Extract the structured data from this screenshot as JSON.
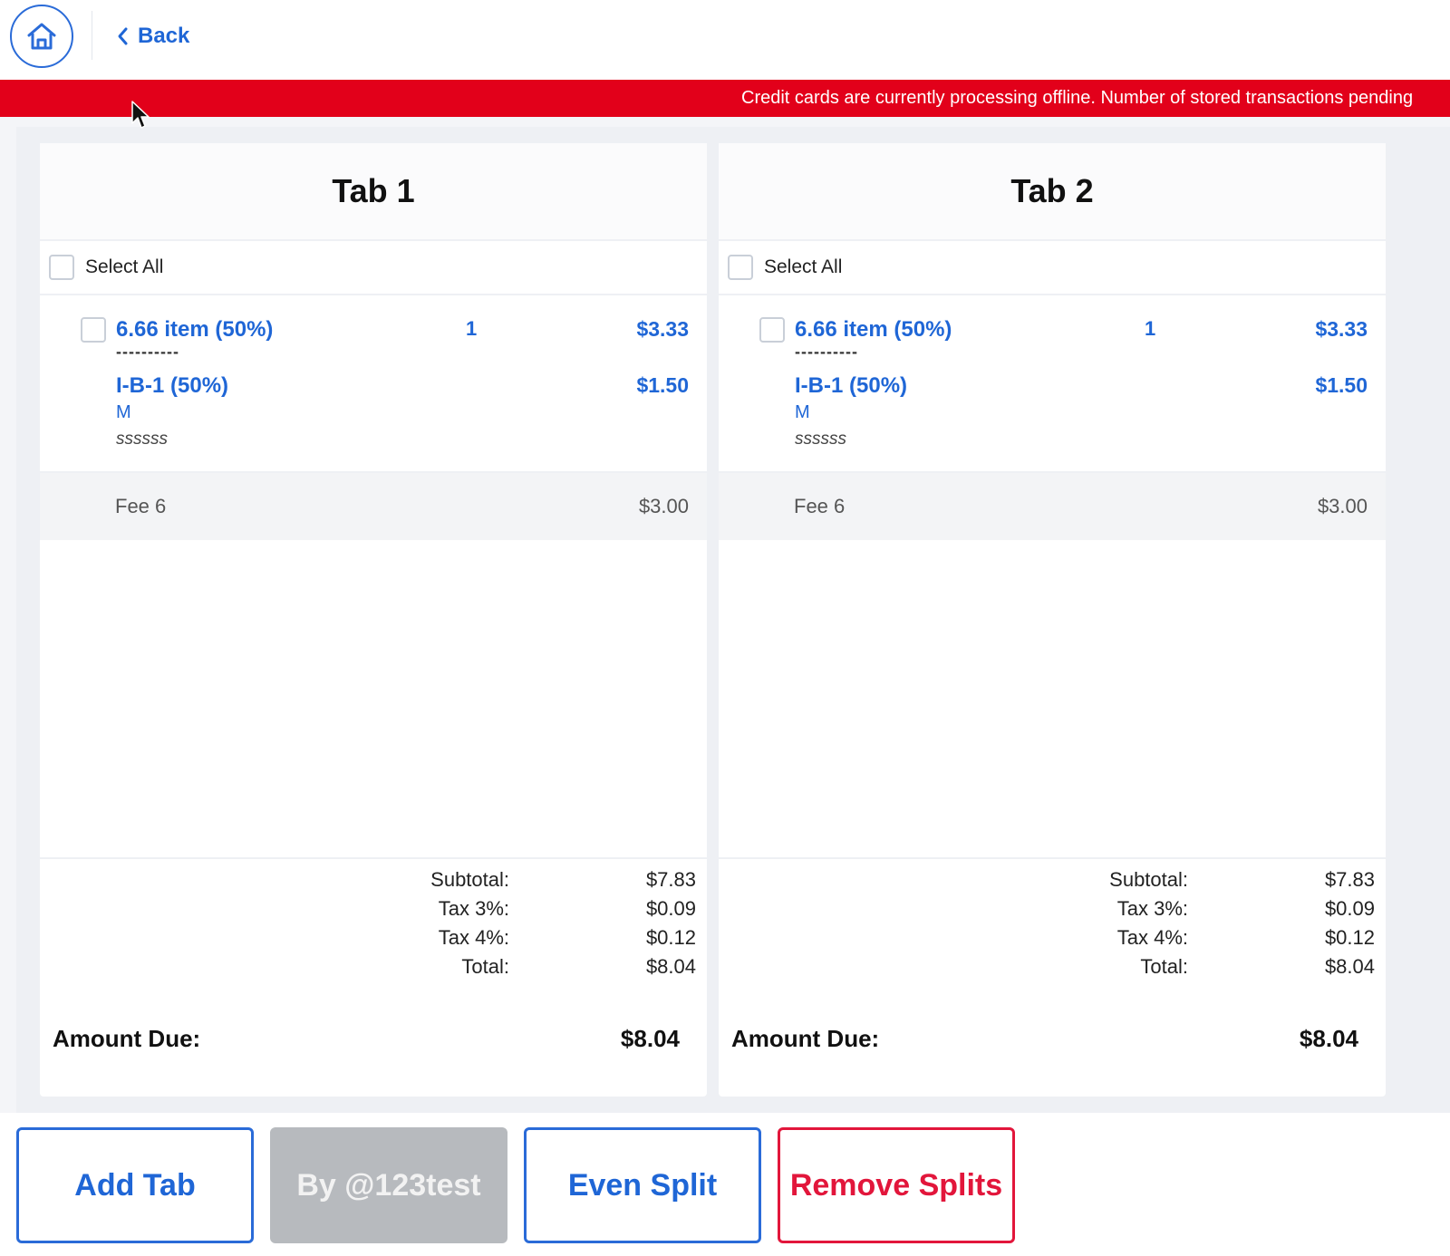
{
  "nav": {
    "back_label": "Back"
  },
  "banner": {
    "text": "Credit cards are currently processing offline. Number of stored transactions pending"
  },
  "select_all_label": "Select All",
  "tabs": [
    {
      "title": "Tab 1",
      "item": {
        "name": "6.66 item (50%)",
        "qty": "1",
        "price": "$3.33",
        "separator": "----------",
        "modifier": "I-B-1 (50%)",
        "modifier_price": "$1.50",
        "size": "M",
        "note": "ssssss"
      },
      "fee": {
        "label": "Fee 6",
        "amount": "$3.00"
      },
      "totals": {
        "subtotal_label": "Subtotal:",
        "subtotal": "$7.83",
        "tax3_label": "Tax 3%:",
        "tax3": "$0.09",
        "tax4_label": "Tax 4%:",
        "tax4": "$0.12",
        "total_label": "Total:",
        "total": "$8.04"
      },
      "amount_due_label": "Amount Due:",
      "amount_due": "$8.04"
    },
    {
      "title": "Tab 2",
      "item": {
        "name": "6.66 item (50%)",
        "qty": "1",
        "price": "$3.33",
        "separator": "----------",
        "modifier": "I-B-1 (50%)",
        "modifier_price": "$1.50",
        "size": "M",
        "note": "ssssss"
      },
      "fee": {
        "label": "Fee 6",
        "amount": "$3.00"
      },
      "totals": {
        "subtotal_label": "Subtotal:",
        "subtotal": "$7.83",
        "tax3_label": "Tax 3%:",
        "tax3": "$0.09",
        "tax4_label": "Tax 4%:",
        "tax4": "$0.12",
        "total_label": "Total:",
        "total": "$8.04"
      },
      "amount_due_label": "Amount Due:",
      "amount_due": "$8.04"
    }
  ],
  "actions": {
    "add_tab": "Add Tab",
    "by_user": "By @123test",
    "even_split": "Even Split",
    "remove_splits": "Remove Splits"
  },
  "colors": {
    "accent_blue": "#1f66d6",
    "banner_red": "#e2001a",
    "remove_red": "#e2163b",
    "disabled_gray": "#b7babe"
  },
  "icons": {
    "home": "home-icon",
    "back": "chevron-left-icon",
    "cursor": "mouse-pointer-icon"
  }
}
